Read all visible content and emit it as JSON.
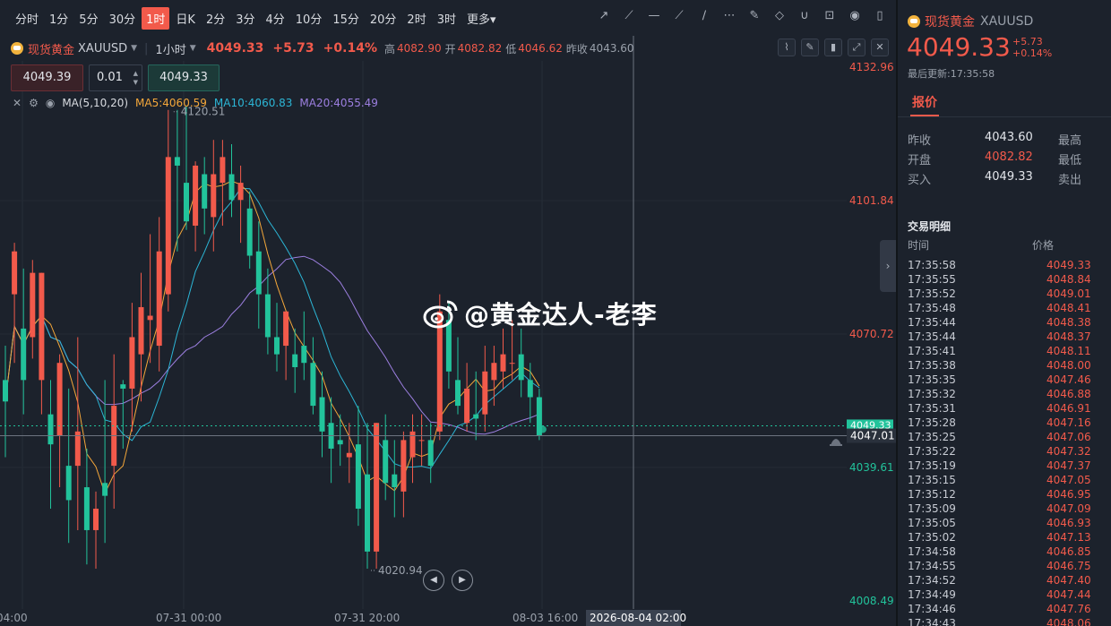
{
  "timeframes": [
    "分时",
    "1分",
    "5分",
    "30分",
    "1时",
    "日K",
    "2分",
    "3分",
    "4分",
    "10分",
    "15分",
    "20分",
    "2时",
    "3时",
    "更多▾"
  ],
  "active_timeframe": "1时",
  "toolbar_icons": [
    "trend-line-icon",
    "ray-icon",
    "horizontal-line-icon",
    "segment-icon",
    "brush-icon",
    "more-dots-icon",
    "edit-icon",
    "eraser-icon",
    "magnet-icon",
    "unlock-icon",
    "eye-icon",
    "trash-icon"
  ],
  "symbol": {
    "name": "现货黄金",
    "code": "XAUUSD",
    "interval": "1小时",
    "price": "4049.33",
    "change": "+5.73",
    "change_pct": "+0.14%",
    "high_label": "高",
    "high": "4082.90",
    "open_label": "开",
    "open": "4082.82",
    "low_label": "低",
    "low": "4046.62",
    "prev_label": "昨收",
    "prev": "4043.60"
  },
  "order": {
    "sell_price": "4049.39",
    "lot": "0.01",
    "buy_price": "4049.33"
  },
  "ma": {
    "label": "MA(5,10,20)",
    "ma5": "MA5:4060.59",
    "ma10": "MA10:4060.83",
    "ma20": "MA20:4055.49",
    "colors": {
      "ma5": "#f4a73a",
      "ma10": "#2cb6d6",
      "ma20": "#9c7fe0"
    }
  },
  "y_axis": [
    "4132.96",
    "4101.84",
    "4070.72",
    "4047.01",
    "4039.61",
    "4008.49"
  ],
  "current_price_tag": "4049.33",
  "x_axis": [
    "04:00",
    "07-31 00:00",
    "07-31 20:00",
    "08-03 16:00"
  ],
  "crosshair_time": "2026-08-04 02:00",
  "high_annotation": "4120.51",
  "low_annotation": "4020.94",
  "watermark": "@黄金达人-老李",
  "colors": {
    "up": "#f25a4b",
    "down": "#22c39b",
    "bg": "#1c222c"
  },
  "right": {
    "title": "现货黄金",
    "code": "XAUUSD",
    "price": "4049.33",
    "change": "+5.73",
    "change_pct": "+0.14%",
    "updated": "最后更新:17:35:58",
    "tab": "报价",
    "quote": [
      {
        "label": "昨收",
        "value": "4043.60",
        "label2": "最高"
      },
      {
        "label": "开盘",
        "value": "4082.82",
        "label2": "最低"
      },
      {
        "label": "买入",
        "value": "4049.33",
        "label2": "卖出"
      }
    ],
    "trades_title": "交易明细",
    "col_time": "时间",
    "col_price": "价格",
    "trades": [
      [
        "17:35:58",
        "4049.33"
      ],
      [
        "17:35:55",
        "4048.84"
      ],
      [
        "17:35:52",
        "4049.01"
      ],
      [
        "17:35:48",
        "4048.41"
      ],
      [
        "17:35:44",
        "4048.38"
      ],
      [
        "17:35:44",
        "4048.37"
      ],
      [
        "17:35:41",
        "4048.11"
      ],
      [
        "17:35:38",
        "4048.00"
      ],
      [
        "17:35:35",
        "4047.46"
      ],
      [
        "17:35:32",
        "4046.88"
      ],
      [
        "17:35:31",
        "4046.91"
      ],
      [
        "17:35:28",
        "4047.16"
      ],
      [
        "17:35:25",
        "4047.06"
      ],
      [
        "17:35:22",
        "4047.32"
      ],
      [
        "17:35:19",
        "4047.37"
      ],
      [
        "17:35:15",
        "4047.05"
      ],
      [
        "17:35:12",
        "4046.95"
      ],
      [
        "17:35:09",
        "4047.09"
      ],
      [
        "17:35:05",
        "4046.93"
      ],
      [
        "17:35:02",
        "4047.13"
      ],
      [
        "17:34:58",
        "4046.85"
      ],
      [
        "17:34:55",
        "4046.75"
      ],
      [
        "17:34:52",
        "4047.40"
      ],
      [
        "17:34:49",
        "4047.44"
      ],
      [
        "17:34:46",
        "4047.76"
      ],
      [
        "17:34:43",
        "4048.06"
      ]
    ]
  },
  "candles": [
    [
      4060,
      4068,
      4042,
      4055
    ],
    [
      4080,
      4092,
      4064,
      4090
    ],
    [
      4072,
      4086,
      4052,
      4060
    ],
    [
      4070,
      4088,
      4065,
      4085
    ],
    [
      4060,
      4085,
      4052,
      4085
    ],
    [
      4052,
      4060,
      4030,
      4045
    ],
    [
      4047,
      4066,
      4035,
      4064
    ],
    [
      4040,
      4058,
      4022,
      4032
    ],
    [
      4040,
      4070,
      4025,
      4048
    ],
    [
      4035,
      4044,
      4017,
      4025
    ],
    [
      4025,
      4034,
      4016,
      4030
    ],
    [
      4036,
      4060,
      4022,
      4033
    ],
    [
      4040,
      4066,
      4030,
      4054
    ],
    [
      4059,
      4060,
      4044,
      4058
    ],
    [
      4058,
      4078,
      4048,
      4070
    ],
    [
      4066,
      4085,
      4055,
      4077
    ],
    [
      4074,
      4094,
      4064,
      4075
    ],
    [
      4068,
      4098,
      4062,
      4090
    ],
    [
      4080,
      4123,
      4076,
      4112
    ],
    [
      4112,
      4123,
      4090,
      4110
    ],
    [
      4106,
      4124,
      4095,
      4097
    ],
    [
      4096,
      4111,
      4090,
      4110
    ],
    [
      4108,
      4112,
      4094,
      4100
    ],
    [
      4098,
      4116,
      4090,
      4108
    ],
    [
      4106,
      4116,
      4096,
      4112
    ],
    [
      4108,
      4115,
      4098,
      4102
    ],
    [
      4102,
      4110,
      4092,
      4106
    ],
    [
      4100,
      4104,
      4086,
      4089
    ],
    [
      4090,
      4097,
      4072,
      4080
    ],
    [
      4080,
      4086,
      4066,
      4070
    ],
    [
      4070,
      4078,
      4062,
      4066
    ],
    [
      4068,
      4076,
      4060,
      4076
    ],
    [
      4066,
      4072,
      4057,
      4063
    ],
    [
      4068,
      4076,
      4060,
      4064
    ],
    [
      4064,
      4070,
      4052,
      4054
    ],
    [
      4056,
      4062,
      4042,
      4048
    ],
    [
      4050,
      4056,
      4036,
      4044
    ],
    [
      4046,
      4052,
      4040,
      4045
    ],
    [
      4042,
      4050,
      4036,
      4043
    ],
    [
      4045,
      4054,
      4026,
      4030
    ],
    [
      4038,
      4050,
      4016,
      4020
    ],
    [
      4020,
      4050,
      4016,
      4050
    ],
    [
      4046,
      4052,
      4032,
      4036
    ],
    [
      4038,
      4046,
      4028,
      4035
    ],
    [
      4034,
      4048,
      4028,
      4046
    ],
    [
      4042,
      4052,
      4036,
      4048
    ],
    [
      4046,
      4052,
      4040,
      4046
    ],
    [
      4046,
      4050,
      4036,
      4040
    ],
    [
      4048,
      4080,
      4046,
      4076
    ],
    [
      4074,
      4078,
      4058,
      4062
    ],
    [
      4060,
      4070,
      4052,
      4054
    ],
    [
      4050,
      4064,
      4048,
      4058
    ],
    [
      4052,
      4062,
      4046,
      4051
    ],
    [
      4052,
      4068,
      4048,
      4062
    ],
    [
      4060,
      4068,
      4054,
      4064
    ],
    [
      4062,
      4072,
      4058,
      4066
    ],
    [
      4064,
      4074,
      4060,
      4064
    ],
    [
      4066,
      4072,
      4056,
      4060
    ],
    [
      4060,
      4064,
      4050,
      4056
    ],
    [
      4056,
      4058,
      4046,
      4047
    ]
  ]
}
